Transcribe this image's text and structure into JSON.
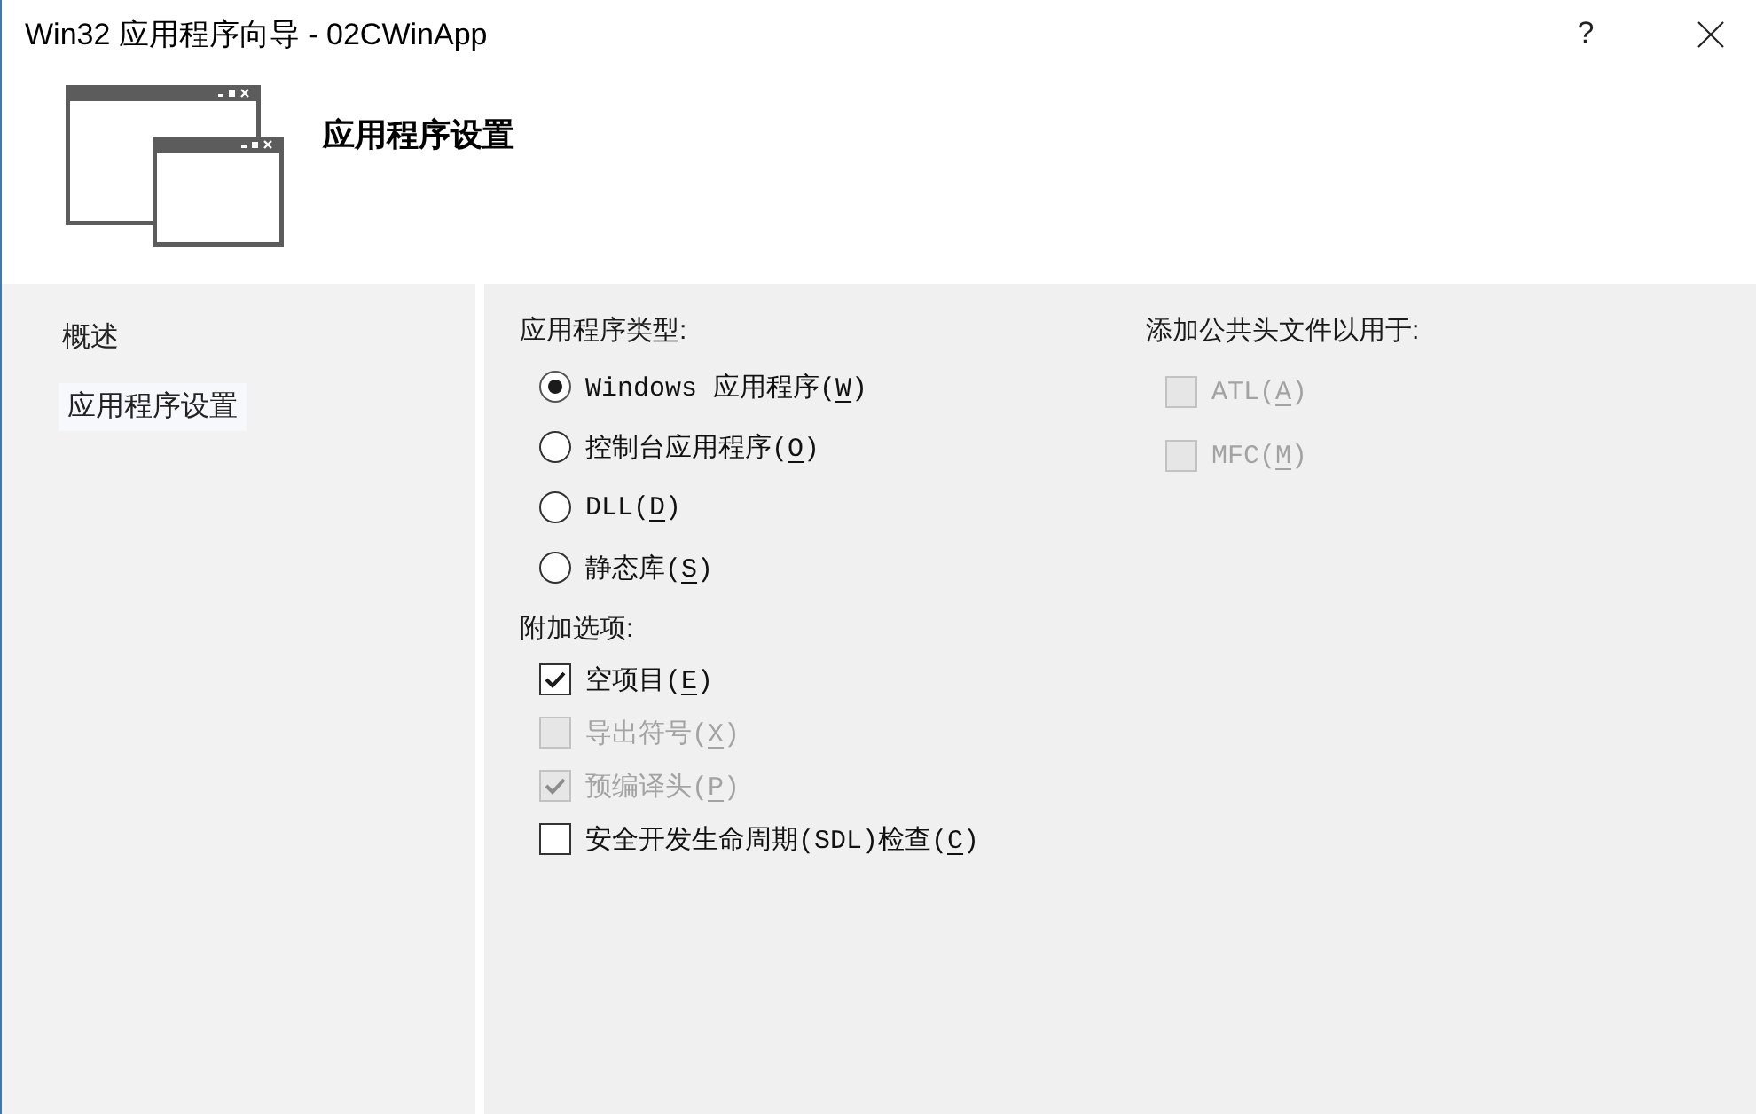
{
  "window": {
    "title": "Win32 应用程序向导 - 02CWinApp",
    "help_button": "?"
  },
  "header": {
    "title": "应用程序设置"
  },
  "sidebar": {
    "items": [
      {
        "label": "概述",
        "selected": false
      },
      {
        "label": "应用程序设置",
        "selected": true
      }
    ]
  },
  "application_type": {
    "title": "应用程序类型:",
    "options": [
      {
        "label": "Windows 应用程序(",
        "access_key": "W",
        "label_end": ")",
        "selected": true
      },
      {
        "label": "控制台应用程序(",
        "access_key": "O",
        "label_end": ")",
        "selected": false
      },
      {
        "label": "DLL(",
        "access_key": "D",
        "label_end": ")",
        "selected": false
      },
      {
        "label": "静态库(",
        "access_key": "S",
        "label_end": ")",
        "selected": false
      }
    ]
  },
  "additional_options": {
    "title": "附加选项:",
    "options": [
      {
        "label": "空项目(",
        "access_key": "E",
        "label_end": ")",
        "checked": true,
        "disabled": false
      },
      {
        "label": "导出符号(",
        "access_key": "X",
        "label_end": ")",
        "checked": false,
        "disabled": true
      },
      {
        "label": "预编译头(",
        "access_key": "P",
        "label_end": ")",
        "checked": true,
        "disabled": true
      },
      {
        "label": "安全开发生命周期(SDL)检查(",
        "access_key": "C",
        "label_end": ")",
        "checked": false,
        "disabled": false
      }
    ]
  },
  "common_headers": {
    "title": "添加公共头文件以用于:",
    "options": [
      {
        "label": "ATL(",
        "access_key": "A",
        "label_end": ")",
        "checked": false,
        "disabled": true
      },
      {
        "label": "MFC(",
        "access_key": "M",
        "label_end": ")",
        "checked": false,
        "disabled": true
      }
    ]
  }
}
